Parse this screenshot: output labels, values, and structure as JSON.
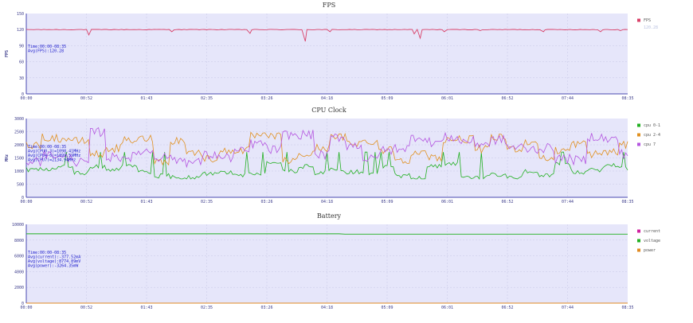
{
  "x_ticks": [
    "00:00",
    "00:52",
    "01:43",
    "02:35",
    "03:26",
    "04:18",
    "05:09",
    "06:01",
    "06:52",
    "07:44",
    "08:35"
  ],
  "chart_data": [
    {
      "type": "line",
      "title": "FPS",
      "ylabel": "FPS",
      "ylim": [
        0,
        150
      ],
      "y_ticks": [
        "0",
        "30",
        "60",
        "90",
        "120",
        "150"
      ],
      "grid": true,
      "legend_position": "right",
      "legend_secondary": "120.28",
      "stats": [
        "Time:00:00-08:35",
        "Avg(FPS):120.28"
      ],
      "series": [
        {
          "name": "FPS",
          "color": "#d94068",
          "baseline": 120,
          "dips": [
            [
              0.104,
              110
            ],
            [
              0.242,
              116
            ],
            [
              0.372,
              113
            ],
            [
              0.464,
              98
            ],
            [
              0.505,
              116
            ],
            [
              0.645,
              112
            ],
            [
              0.655,
              104
            ],
            [
              0.695,
              116
            ],
            [
              0.755,
              118
            ],
            [
              0.86,
              116
            ],
            [
              0.955,
              116
            ],
            [
              0.988,
              118
            ]
          ]
        }
      ]
    },
    {
      "type": "line",
      "title": "CPU Clock",
      "ylabel": "MHz",
      "ylim": [
        0,
        3000
      ],
      "y_ticks": [
        "0",
        "500",
        "1000",
        "1500",
        "2000",
        "2500",
        "3000"
      ],
      "grid": true,
      "legend_position": "right",
      "stats": [
        "Time:00:00-08:35",
        "Avg(CPU0-3)=1098.41MHz",
        "Avg(CPU4-6)=1899.59MHz",
        "Avg(CPU7)=2134.94MHz"
      ],
      "series": [
        {
          "name": "cpu 0-1",
          "color": "#22b022",
          "base": 1000,
          "amp": 300
        },
        {
          "name": "cpu 2-4",
          "color": "#e09020",
          "base": 1850,
          "amp": 500
        },
        {
          "name": "cpu 7",
          "color": "#b455e0",
          "base": 1900,
          "amp": 600
        }
      ]
    },
    {
      "type": "line",
      "title": "Battery",
      "ylim": [
        0,
        10000
      ],
      "y_ticks": [
        "0",
        "2000",
        "4000",
        "6000",
        "8000",
        "10000"
      ],
      "grid": true,
      "legend_position": "right",
      "stats": [
        "Time:00:00-08:35",
        "Avg(current):-377.52mA",
        "Avg(voltage):8774.89mV",
        "Avg(power):-3264.35mW"
      ],
      "series": [
        {
          "name": "current",
          "color": "#d020a0",
          "y": -377.52
        },
        {
          "name": "voltage",
          "color": "#22b022",
          "y_start": 8800,
          "y_end": 8760
        },
        {
          "name": "power",
          "color": "#e08a20",
          "y": -3264.35
        }
      ]
    }
  ]
}
